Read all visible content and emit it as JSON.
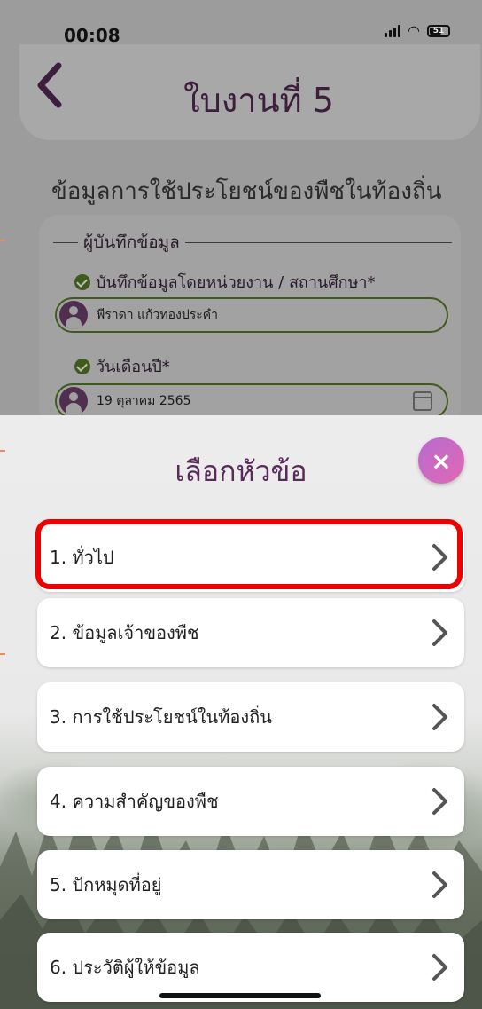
{
  "status_bar": {
    "time": "00:08",
    "battery": "51"
  },
  "header": {
    "title": "ใบงานที่ 5"
  },
  "section": {
    "title": "ข้อมูลการใช้ประโยชน์ของพืชในท้องถิ่น"
  },
  "form": {
    "legend": "ผู้บันทึกข้อมูล",
    "recorder_label": "บันทึกข้อมูลโดยหน่วยงาน / สถานศึกษา*",
    "recorder_value": "พีราดา แก้วทองประคำ",
    "date_label": "วันเดือนปี*",
    "date_value": "19 ตุลาคม 2565"
  },
  "sheet": {
    "title": "เลือกหัวข้อ",
    "close_label": "×",
    "topics": [
      {
        "label": "1. ทั่วไป"
      },
      {
        "label": "2. ข้อมูลเจ้าของพืช"
      },
      {
        "label": "3. การใช้ประโยชน์ในท้องถิ่น"
      },
      {
        "label": "4. ความสำคัญของพืช"
      },
      {
        "label": "5. ปักหมุดที่อยู่"
      },
      {
        "label": "6. ประวัติผู้ให้ข้อมูล"
      }
    ]
  },
  "colors": {
    "accent": "#5a2a5a",
    "check": "#3f5a1c",
    "highlight": "#ee0000"
  }
}
